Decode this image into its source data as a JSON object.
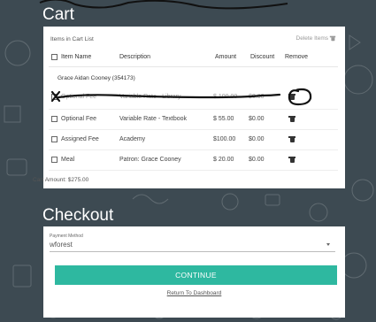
{
  "cart": {
    "title": "Cart",
    "items_label": "Items in Cart List",
    "delete_items_label": "Delete Items",
    "columns": {
      "item_name": "Item Name",
      "description": "Description",
      "amount": "Amount",
      "discount": "Discount",
      "remove": "Remove"
    },
    "student": "Grace Aidan Cooney (354173)",
    "rows": [
      {
        "name": "Optional Fee",
        "description": "Variable Rate - Library",
        "amount": "$ 100.00",
        "discount": "$0.00"
      },
      {
        "name": "Optional Fee",
        "description": "Variable Rate - Textbook",
        "amount": "$ 55.00",
        "discount": "$0.00"
      },
      {
        "name": "Assigned Fee",
        "description": "Academy",
        "amount": "$100.00",
        "discount": "$0.00"
      },
      {
        "name": "Meal",
        "description": "Patron: Grace Cooney",
        "amount": "$ 20.00",
        "discount": "$0.00"
      }
    ],
    "cart_amount": "Cart Amount: $275.00"
  },
  "checkout": {
    "title": "Checkout",
    "payment_method_label": "Payment Method",
    "payment_method_value": "wforest",
    "continue_label": "CONTINUE",
    "return_label": "Return To Dashboard"
  },
  "colors": {
    "background": "#3d4a52",
    "accent": "#2eb8a0",
    "panel": "#ffffff"
  }
}
